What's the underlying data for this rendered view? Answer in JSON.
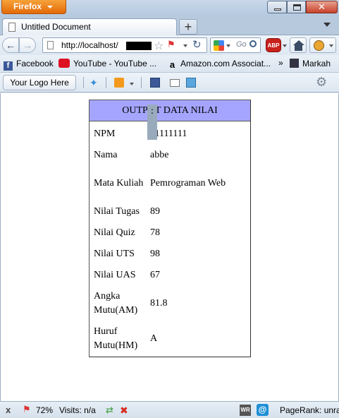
{
  "window": {
    "app_button": "Firefox",
    "close_symbol": "✕"
  },
  "tabs": [
    {
      "title": "Untitled Document"
    }
  ],
  "nav": {
    "url": "http://localhost/",
    "search_placeholder": "Go",
    "abp_label": "ABP"
  },
  "bookmarks": [
    {
      "label": "Facebook",
      "icon": "facebook-icon"
    },
    {
      "label": "YouTube - YouTube ...",
      "icon": "youtube-icon"
    },
    {
      "label": "Amazon.com Associat...",
      "icon": "amazon-icon"
    },
    {
      "label": "Markah",
      "icon": "bookmark-icon"
    }
  ],
  "bookmarks_more": "»",
  "toolbar": {
    "logo_button": "Your Logo Here"
  },
  "panel": {
    "title": "OUTPUT DATA NILAI",
    "separator": ":",
    "rows": [
      {
        "label": "NPM",
        "value": "11111111"
      },
      {
        "label": "Nama",
        "value": "abbe"
      },
      {
        "label": "Mata Kuliah",
        "value": "Pemrograman Web"
      },
      {
        "label": "Nilai Tugas",
        "value": "89"
      },
      {
        "label": "Nilai Quiz",
        "value": "78"
      },
      {
        "label": "Nilai UTS",
        "value": "98"
      },
      {
        "label": "Nilai UAS",
        "value": "67"
      },
      {
        "label": "Angka Mutu(AM)",
        "value": "81.8"
      },
      {
        "label": "Huruf Mutu(HM)",
        "value": "A"
      }
    ]
  },
  "status": {
    "close": "x",
    "zoom": "72%",
    "visits": "Visits: n/a",
    "wr": "WR",
    "at": "@",
    "pagerank": "PageRank: unra"
  }
}
